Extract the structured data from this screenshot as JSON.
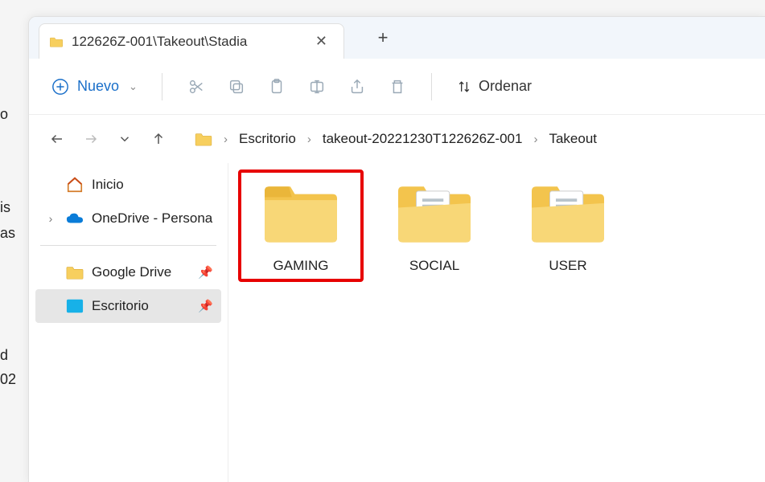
{
  "edge": {
    "t1": "o",
    "t2": "is",
    "t3": "as",
    "t4": "d",
    "t5": "02"
  },
  "tab": {
    "title": "122626Z-001\\Takeout\\Stadia"
  },
  "toolbar": {
    "new_label": "Nuevo",
    "sort_label": "Ordenar"
  },
  "breadcrumb": {
    "items": [
      "Escritorio",
      "takeout-20221230T122626Z-001",
      "Takeout"
    ]
  },
  "sidebar": {
    "home": "Inicio",
    "onedrive": "OneDrive - Personal",
    "gdrive": "Google Drive",
    "desktop": "Escritorio"
  },
  "folders": [
    {
      "name": "GAMING",
      "type": "empty",
      "highlighted": true
    },
    {
      "name": "SOCIAL",
      "type": "docs",
      "highlighted": false
    },
    {
      "name": "USER",
      "type": "docs",
      "highlighted": false
    }
  ]
}
